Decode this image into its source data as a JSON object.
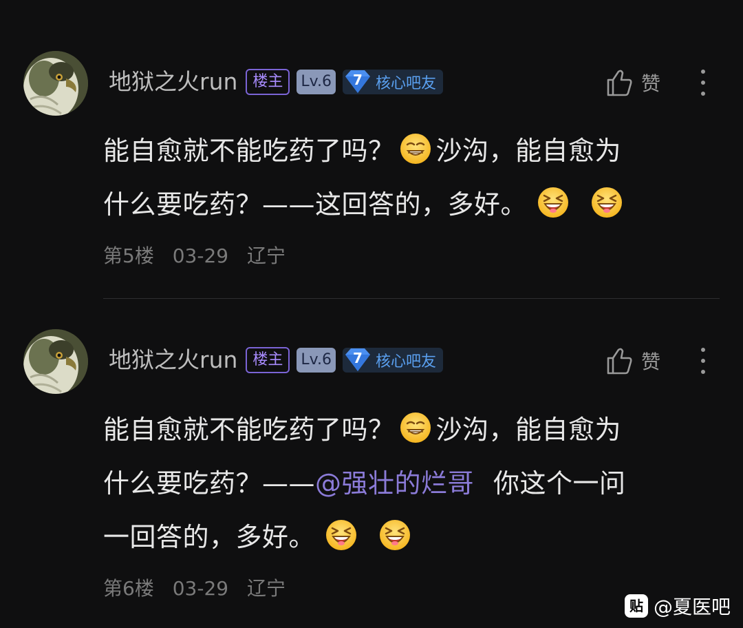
{
  "posts": [
    {
      "username": "地狱之火run",
      "owner_badge": "楼主",
      "level_badge": "Lv.6",
      "core_number": "7",
      "core_label": "核心吧友",
      "like_label": "赞",
      "content": {
        "line1_a": "能自愈就不能吃药了吗？",
        "line1_b": "沙沟，能自愈为",
        "line2_a": "什么要吃药？——这回答的，多好。"
      },
      "floor": "第5楼",
      "date": "03-29",
      "location": "辽宁"
    },
    {
      "username": "地狱之火run",
      "owner_badge": "楼主",
      "level_badge": "Lv.6",
      "core_number": "7",
      "core_label": "核心吧友",
      "like_label": "赞",
      "content": {
        "line1_a": "能自愈就不能吃药了吗？",
        "line1_b": "沙沟，能自愈为",
        "line2_a": "什么要吃药？——",
        "mention": "@强壮的烂哥",
        "line2_b": "你这个一问",
        "line3_a": "一回答的，多好。"
      },
      "floor": "第6楼",
      "date": "03-29",
      "location": "辽宁"
    }
  ],
  "watermark": {
    "icon_text": "贴",
    "text": "@夏医吧"
  },
  "icons": {
    "like": "thumbs-up-icon",
    "more": "more-vertical-icon",
    "emoji_smirk": "smirk-emoji-icon",
    "emoji_laugh": "laughing-emoji-icon"
  },
  "colors": {
    "background": "#0f0f10",
    "mention": "#8b7bd8",
    "owner_badge": "#a98cff",
    "core_badge": "#5aa0f0"
  }
}
